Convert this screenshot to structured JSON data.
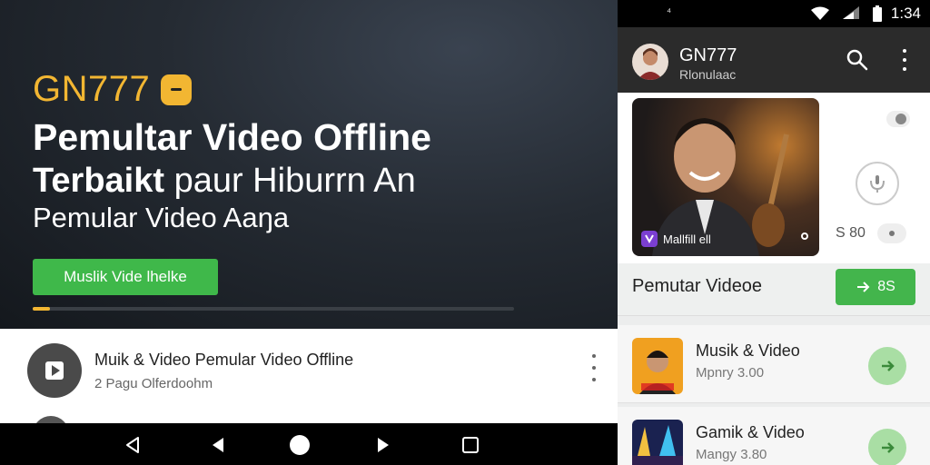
{
  "hero": {
    "brand": "GN777",
    "headline_1": "Pemultar Video Offline",
    "headline_2_bold": "Terbaikt",
    "headline_2_rest": " paur Hiburrn An",
    "headline_3": "Pemular Video Aaŋa",
    "cta_label": "Muslik Vide lhelke",
    "progress_fraction": 0.035
  },
  "left_list": {
    "items": [
      {
        "title": "Muik & Video Pemular Video Offline",
        "subtitle": "2 Pagu Olferdoohm",
        "icon": "play-icon"
      }
    ]
  },
  "navbar": {
    "icons": [
      "back-icon",
      "back-filled-icon",
      "home-icon",
      "forward-icon",
      "recents-icon"
    ]
  },
  "status_bar": {
    "time": "1:34",
    "notification": "⁴"
  },
  "app_bar": {
    "title": "GN777",
    "subtitle": "Rlonulaac",
    "icons": [
      "search-icon",
      "more-vert-icon"
    ]
  },
  "video_card": {
    "thumb_label": "Mallfill ell",
    "count": "S 80"
  },
  "section": {
    "title": "Pemutar Videoe",
    "button_label": "8S"
  },
  "list": [
    {
      "title": "Musik & Video",
      "subtitle": "Mpnry 3.00"
    },
    {
      "title": "Gamik & Video",
      "subtitle": "Mangy 3.80"
    }
  ],
  "colors": {
    "accent_gold": "#f2b632",
    "accent_green": "#43b54c",
    "light_green": "#a9dea4",
    "app_bar": "#2b2b2b"
  }
}
